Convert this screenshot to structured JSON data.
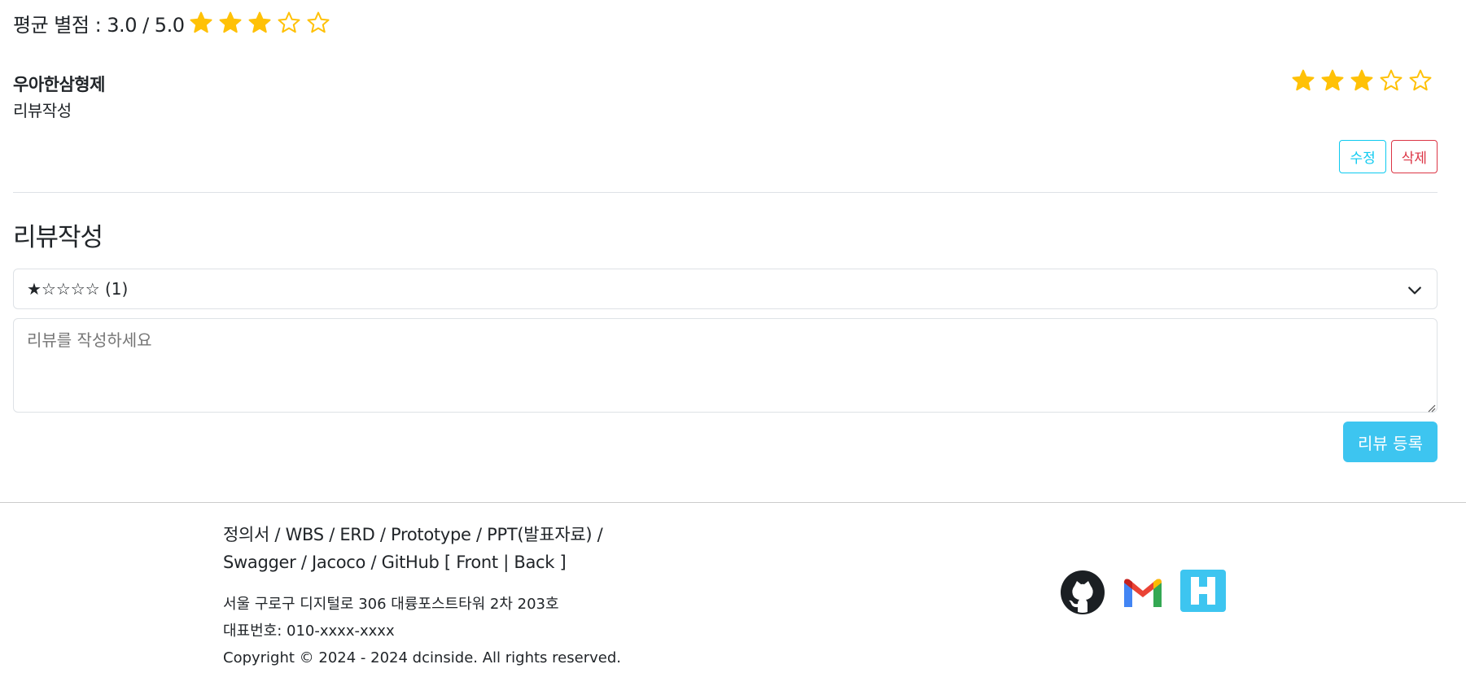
{
  "average": {
    "label": "평균 별점 : 3.0 / 5.0",
    "rating": 3,
    "max_rating": 5
  },
  "colors": {
    "star": "#ffc107",
    "info": "#0dcaf0",
    "danger": "#dc3545",
    "submit": "#3dc5f0"
  },
  "review": {
    "author": "우아한삼형제",
    "content": "리뷰작성",
    "rating": 3,
    "max_rating": 5,
    "edit_label": "수정",
    "delete_label": "삭제"
  },
  "form": {
    "title": "리뷰작성",
    "rating_select_value": "★☆☆☆☆ (1)",
    "textarea_placeholder": "리뷰를 작성하세요",
    "submit_label": "리뷰 등록"
  },
  "footer": {
    "links_line1": "정의서 / WBS / ERD / Prototype / PPT(발표자료) /",
    "links_line2": "Swagger / Jacoco / GitHub [ Front | Back ]",
    "address": "서울 구로구 디지털로 306 대륭포스트타워 2차 203호",
    "phone": "대표번호: 010-xxxx-xxxx",
    "copyright": "Copyright © 2024 - 2024 dcinside. All rights reserved.",
    "icons": [
      "github-icon",
      "gmail-icon",
      "hashnode-icon"
    ]
  }
}
